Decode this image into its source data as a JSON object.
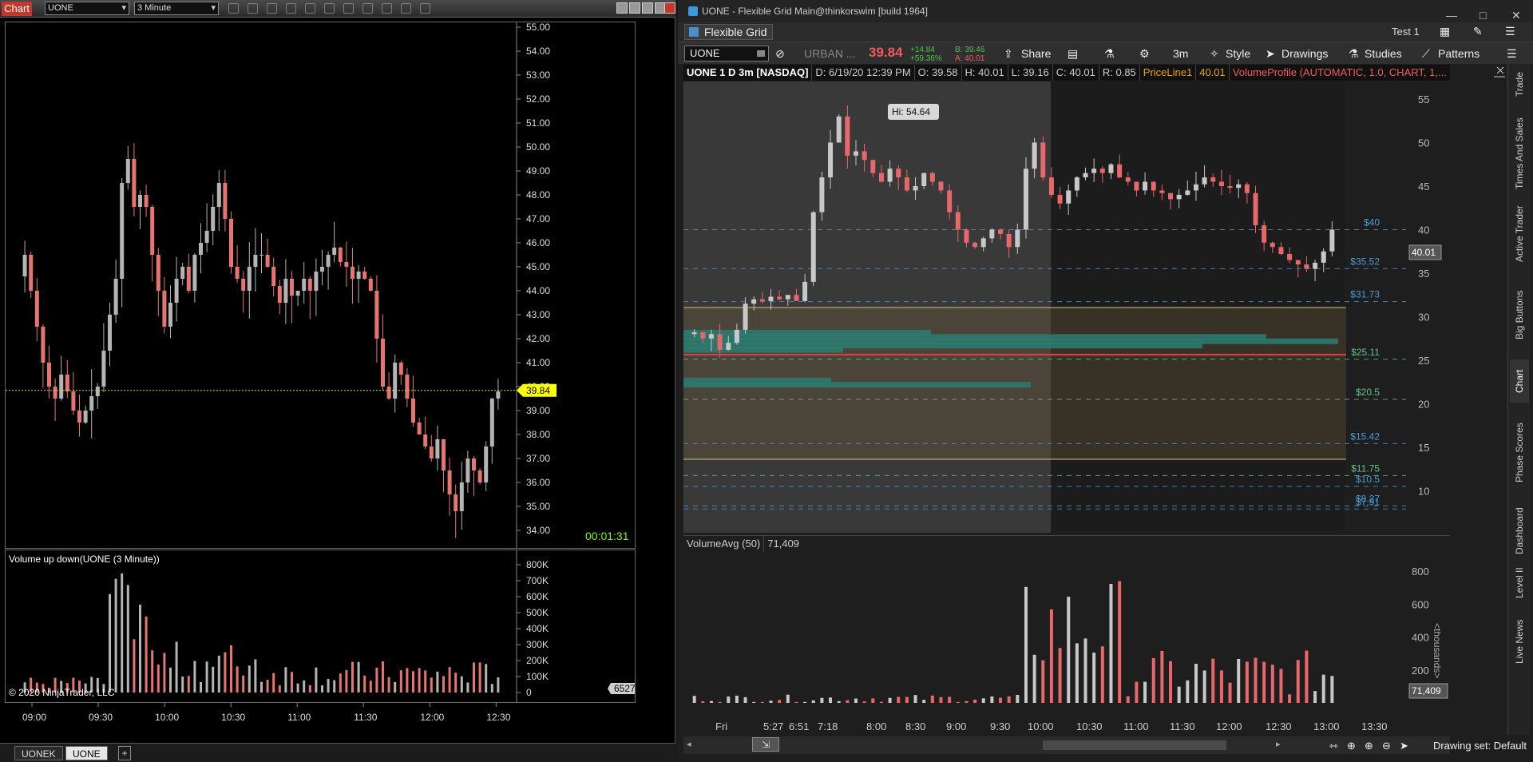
{
  "ninja": {
    "title_badge": "Chart",
    "instrument": "UONE",
    "interval": "3 Minute",
    "last_price": "39.84",
    "countdown": "00:01:31",
    "volume_panel_label": "Volume up down(UONE (3 Minute))",
    "copyright": "© 2020 NinjaTrader, LLC",
    "last_volume": "65279",
    "tabs": [
      "UONEK",
      "UONE"
    ],
    "add_tab": "+",
    "price_ticks": [
      "55.00",
      "54.00",
      "53.00",
      "52.00",
      "51.00",
      "50.00",
      "49.00",
      "48.00",
      "47.00",
      "46.00",
      "45.00",
      "44.00",
      "43.00",
      "42.00",
      "41.00",
      "40.00",
      "39.00",
      "38.00",
      "37.00",
      "36.00",
      "35.00",
      "34.00"
    ],
    "volume_ticks": [
      "800K",
      "700K",
      "600K",
      "500K",
      "400K",
      "300K",
      "200K",
      "100K",
      "0"
    ],
    "time_ticks": [
      "09:00",
      "09:30",
      "10:00",
      "10:30",
      "11:00",
      "11:30",
      "12:00",
      "12:30"
    ],
    "colors": {
      "up": "#b4b4b4",
      "down": "#e87472",
      "priceline": "#e8e800"
    }
  },
  "tos": {
    "window_title": "UONE - Flexible Grid Main@thinkorswim [build 1964]",
    "grid_button": "Flexible Grid",
    "account": "Test 1",
    "symbol": "UONE",
    "company": "URBAN ...",
    "last": "39.84",
    "change": "+14.84",
    "change_pct": "+59.36%",
    "bid": "B: 39.46",
    "ask": "A: 40.01",
    "toolbar": {
      "share": "Share",
      "interval": "3m",
      "style": "Style",
      "drawings": "Drawings",
      "studies": "Studies",
      "patterns": "Patterns"
    },
    "header": {
      "symbol_desc": "UONE 1 D 3m [NASDAQ]",
      "date": "D: 6/19/20 12:39 PM",
      "open": "O: 39.58",
      "high": "H: 40.01",
      "low": "L: 39.16",
      "close": "C: 40.01",
      "range": "R: 0.85",
      "priceline_label": "PriceLine1",
      "priceline_val": "40.01",
      "vp": "VolumeProfile (AUTOMATIC, 1.0, CHART, 1,..."
    },
    "hi_bubble": "Hi: 54.64",
    "price_ticks": [
      "55",
      "50",
      "45",
      "40",
      "35",
      "30",
      "25",
      "20",
      "15",
      "10"
    ],
    "price_box": "40.01",
    "levels": [
      {
        "label": "$40",
        "price": 40,
        "color": "#4a9ad5"
      },
      {
        "label": "$35.52",
        "price": 35.52,
        "color": "#4a9ad5"
      },
      {
        "label": "$31.73",
        "price": 31.73,
        "color": "#4a9ad5"
      },
      {
        "label": "$25.11",
        "price": 25.11,
        "color": "#5fc48e"
      },
      {
        "label": "$20.5",
        "price": 20.5,
        "color": "#5fc48e"
      },
      {
        "label": "$15.42",
        "price": 15.42,
        "color": "#4a9ad5"
      },
      {
        "label": "$11.75",
        "price": 11.75,
        "color": "#5fc48e"
      },
      {
        "label": "$10.5",
        "price": 10.5,
        "color": "#4a9ad5"
      },
      {
        "label": "$8.27",
        "price": 8.27,
        "color": "#4a9ad5"
      },
      {
        "label": "$7.91",
        "price": 7.91,
        "color": "#4a9ad5"
      }
    ],
    "volume_study": "VolumeAvg (50)",
    "volume_value": "71,409",
    "volume_box": "71,409",
    "volume_ticks": [
      "800",
      "600",
      "400",
      "200"
    ],
    "volume_axis_label": "<thousands>",
    "time_ticks": [
      "Fri",
      "5:27",
      "6:51",
      "7:18",
      "8:00",
      "8:30",
      "9:00",
      "9:30",
      "10:00",
      "10:30",
      "11:00",
      "11:30",
      "12:00",
      "12:30",
      "13:00",
      "13:30"
    ],
    "drawing_set": "Drawing set: Default",
    "side_tabs": [
      "Trade",
      "Times And Sales",
      "Active Trader",
      "Big Buttons",
      "Chart",
      "Phase Scores",
      "Dashboard",
      "Level II",
      "Live News"
    ],
    "colors": {
      "up": "#c8c8c8",
      "down": "#e8676a",
      "profile": "#2b7c72"
    }
  }
}
